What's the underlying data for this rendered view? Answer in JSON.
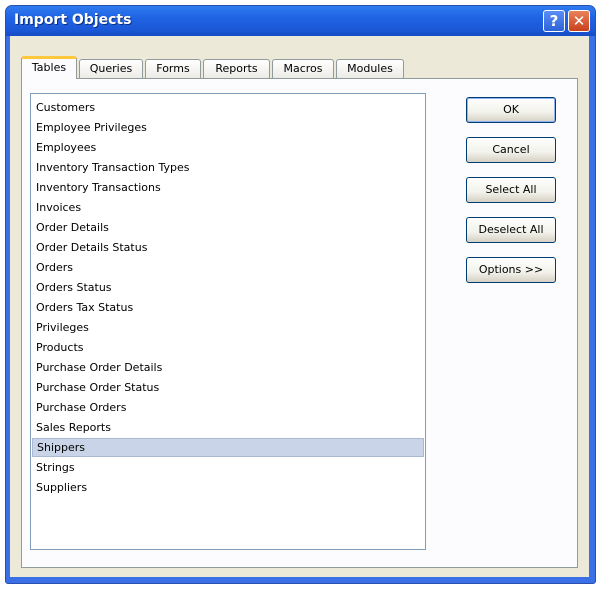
{
  "window": {
    "title": "Import Objects",
    "help_glyph": "?",
    "close_glyph": "✕"
  },
  "tabs": [
    {
      "label": "Tables",
      "active": true
    },
    {
      "label": "Queries",
      "active": false
    },
    {
      "label": "Forms",
      "active": false
    },
    {
      "label": "Reports",
      "active": false
    },
    {
      "label": "Macros",
      "active": false
    },
    {
      "label": "Modules",
      "active": false
    }
  ],
  "list": {
    "items": [
      "Customers",
      "Employee Privileges",
      "Employees",
      "Inventory Transaction Types",
      "Inventory Transactions",
      "Invoices",
      "Order Details",
      "Order Details Status",
      "Orders",
      "Orders Status",
      "Orders Tax Status",
      "Privileges",
      "Products",
      "Purchase Order Details",
      "Purchase Order Status",
      "Purchase Orders",
      "Sales Reports",
      "Shippers",
      "Strings",
      "Suppliers"
    ],
    "selected": "Shippers"
  },
  "buttons": {
    "ok": "OK",
    "cancel": "Cancel",
    "select_all": "Select All",
    "deselect_all": "Deselect All",
    "options": "Options >>"
  },
  "colors": {
    "titlebar": "#1f63e4",
    "dialog_bg": "#ece9d8",
    "selection": "#c9d4e8",
    "active_tab_accent": "#ffc83c"
  }
}
